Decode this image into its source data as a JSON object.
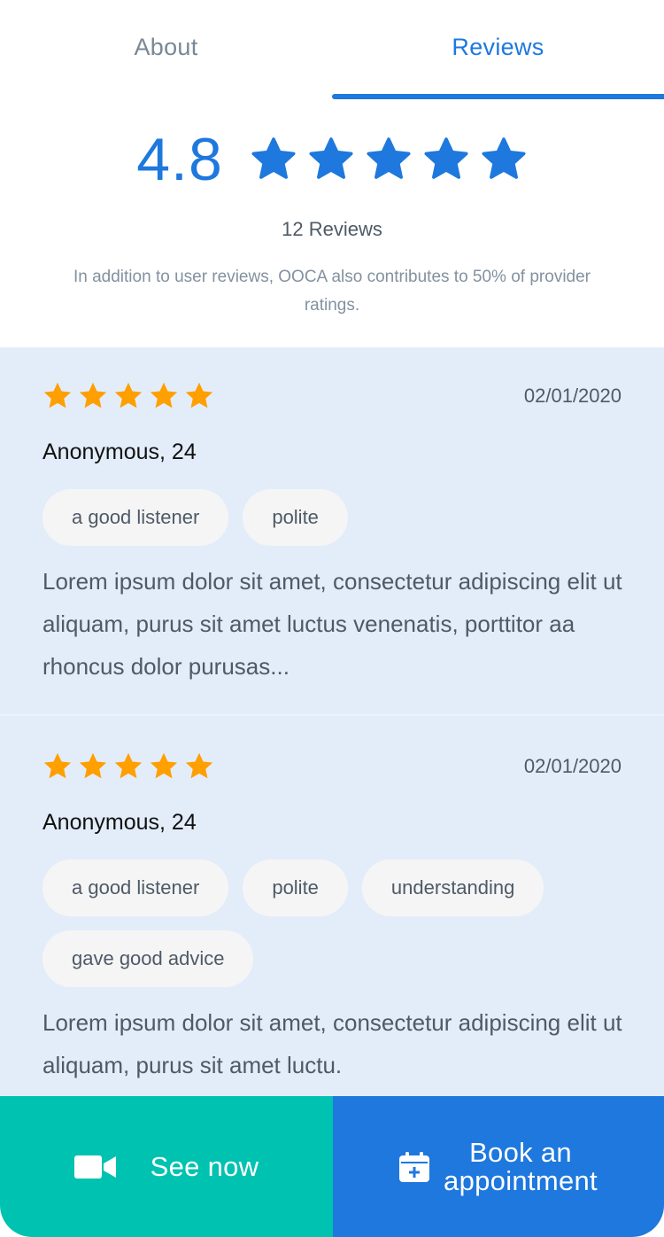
{
  "tabs": [
    {
      "label": "About",
      "active": false
    },
    {
      "label": "Reviews",
      "active": true
    }
  ],
  "summary": {
    "score": "4.8",
    "stars": 5,
    "reviews_count": "12 Reviews",
    "note": "In addition to user reviews, OOCA also contributes to 50% of provider ratings."
  },
  "reviews": [
    {
      "stars": 5,
      "date": "02/01/2020",
      "name": "Anonymous, 24",
      "tags": [
        "a good listener",
        "polite"
      ],
      "text": "Lorem ipsum dolor sit amet, consectetur adipiscing elit ut aliquam, purus sit amet luctus venenatis, porttitor aa rhoncus dolor purusas..."
    },
    {
      "stars": 5,
      "date": "02/01/2020",
      "name": "Anonymous, 24",
      "tags": [
        "a good listener",
        "polite",
        "understanding",
        "gave good advice"
      ],
      "text": "Lorem ipsum dolor sit amet, consectetur adipiscing elit ut aliquam, purus sit amet luctu."
    }
  ],
  "actions": {
    "see_now": "See now",
    "book_line1": "Book an",
    "book_line2": "appointment"
  },
  "icons": {
    "video": "video-camera-icon",
    "calendar": "calendar-add-icon",
    "star": "star-icon"
  },
  "colors": {
    "primary": "#1E78DE",
    "teal": "#00C2B0",
    "star_yellow": "#FF9F00",
    "list_bg": "#E3EDF9",
    "chip_bg": "#F5F5F6"
  }
}
